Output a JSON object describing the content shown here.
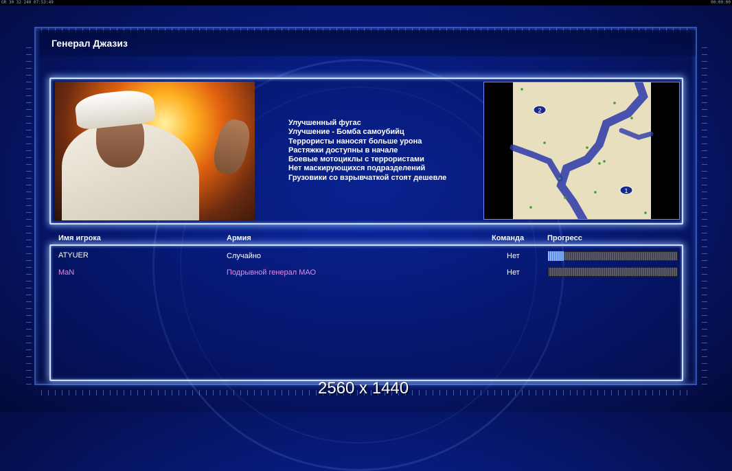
{
  "status_bar": {
    "left": "GR 30 32 240 07:53:49",
    "right": "00:00:00"
  },
  "general": {
    "title": "Генерал Джазиз",
    "bonuses": [
      "Улучшенный фугас",
      "Улучшение - Бомба самоубийц",
      "Террористы наносят больше урона",
      "Растяжки доступны в начале",
      "Боевые мотоциклы с террористами",
      "Нет маскирующихся подразделений",
      "Грузовики со взрывчаткой стоят дешевле"
    ]
  },
  "map": {
    "start_positions": [
      "2",
      "1"
    ]
  },
  "table": {
    "headers": {
      "player": "Имя игрока",
      "army": "Армия",
      "team": "Команда",
      "progress": "Прогресс"
    },
    "rows": [
      {
        "name": "ATYUER",
        "army": "Случайно",
        "team": "Нет",
        "progress_fraction": 0.12,
        "color": "#ffffff"
      },
      {
        "name": "MaN",
        "army": "Подрывной генерал МАО",
        "team": "Нет",
        "progress_fraction": 0.0,
        "color": "#e28ce8"
      }
    ]
  },
  "watermark": "2560 x 1440"
}
